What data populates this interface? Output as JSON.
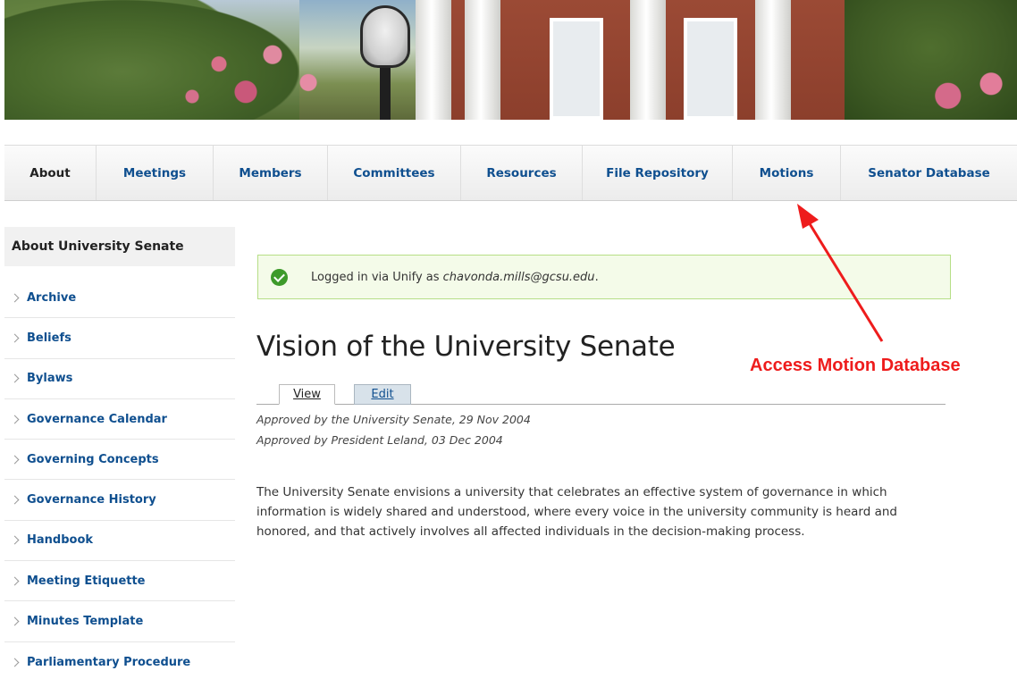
{
  "nav": {
    "items": [
      {
        "label": "About"
      },
      {
        "label": "Meetings"
      },
      {
        "label": "Members"
      },
      {
        "label": "Committees"
      },
      {
        "label": "Resources"
      },
      {
        "label": "File Repository"
      },
      {
        "label": "Motions"
      },
      {
        "label": "Senator Database"
      }
    ]
  },
  "sidebar": {
    "heading": "About University Senate",
    "items": [
      {
        "label": "Archive"
      },
      {
        "label": "Beliefs"
      },
      {
        "label": "Bylaws"
      },
      {
        "label": "Governance Calendar"
      },
      {
        "label": "Governing Concepts"
      },
      {
        "label": "Governance History"
      },
      {
        "label": "Handbook"
      },
      {
        "label": "Meeting Etiquette"
      },
      {
        "label": "Minutes Template"
      },
      {
        "label": "Parliamentary Procedure"
      }
    ]
  },
  "status": {
    "prefix": "Logged in via Unify as ",
    "email": "chavonda.mills@gcsu.edu",
    "suffix": "."
  },
  "main": {
    "title": "Vision of the University Senate",
    "tabs": [
      {
        "label": "View"
      },
      {
        "label": "Edit"
      }
    ],
    "approved_1": "Approved by the University Senate, 29 Nov 2004",
    "approved_2": "Approved by President Leland, 03 Dec 2004",
    "body": "The University Senate envisions a university that celebrates an effective system of governance in which information is widely shared and understood, where every voice in the university community is heard and honored, and that actively involves all affected individuals in the decision-making process."
  },
  "annotation": {
    "label": "Access Motion Database",
    "color": "#ee1c1c"
  },
  "icons": {
    "status": "check-circle-icon",
    "sidebar_bullet": "chevron-right-icon"
  }
}
